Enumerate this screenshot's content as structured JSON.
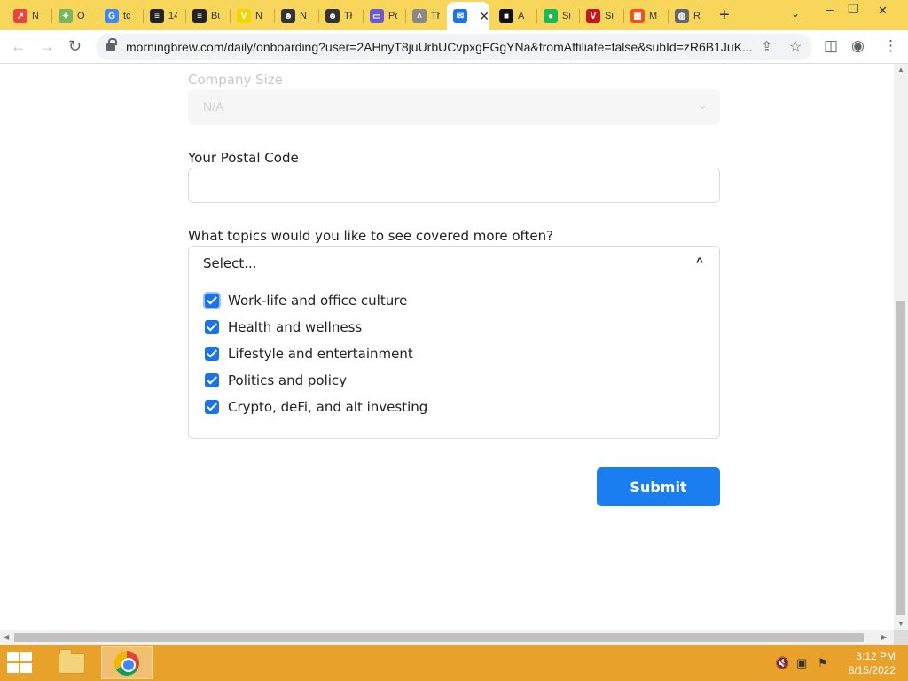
{
  "browser": {
    "tabs": [
      {
        "label": "N",
        "icon": "trending-icon",
        "color": "#e8453c",
        "glyph": "↗"
      },
      {
        "label": "O",
        "icon": "leaf-icon",
        "color": "#7ab55c",
        "glyph": "✦"
      },
      {
        "label": "tc",
        "icon": "google-icon",
        "color": "#4285f4",
        "glyph": "G"
      },
      {
        "label": "14",
        "icon": "layers-icon",
        "color": "#222222",
        "glyph": "≡"
      },
      {
        "label": "Bu",
        "icon": "layers-icon",
        "color": "#222222",
        "glyph": "≡"
      },
      {
        "label": "N",
        "icon": "v-icon",
        "color": "#f2d600",
        "glyph": "V"
      },
      {
        "label": "N",
        "icon": "mascot-icon",
        "color": "#333333",
        "glyph": "☻"
      },
      {
        "label": "Tł",
        "icon": "mascot-icon",
        "color": "#333333",
        "glyph": "☻"
      },
      {
        "label": "Po",
        "icon": "brand-icon",
        "color": "#6a5acd",
        "glyph": "▭"
      },
      {
        "label": "Th",
        "icon": "feather-icon",
        "color": "#888888",
        "glyph": "˄"
      },
      {
        "label": "",
        "icon": "morningbrew-icon",
        "color": "#1a73e8",
        "glyph": "✉",
        "active": true
      },
      {
        "label": "A",
        "icon": "brand-icon",
        "color": "#111111",
        "glyph": "■"
      },
      {
        "label": "Si",
        "icon": "spotify-icon",
        "color": "#1db954",
        "glyph": "●"
      },
      {
        "label": "Si",
        "icon": "v-icon",
        "color": "#c4161c",
        "glyph": "V"
      },
      {
        "label": "M",
        "icon": "microsoft-icon",
        "color": "#f25022",
        "glyph": "▦"
      },
      {
        "label": "R",
        "icon": "globe-icon",
        "color": "#666666",
        "glyph": "◍"
      }
    ],
    "url": "morningbrew.com/daily/onboarding?user=2AHnyT8juUrbUCvpxgFGgYNa&fromAffiliate=false&subId=zR6B1JuK..."
  },
  "form": {
    "company_size_label": "Company Size",
    "company_size_value": "N/A",
    "postal_code_label": "Your Postal Code",
    "postal_code_value": "",
    "topics_label": "What topics would you like to see covered more often?",
    "topics_placeholder": "Select...",
    "topics": [
      {
        "label": "Work-life and office culture",
        "checked": true,
        "focused": true
      },
      {
        "label": "Health and wellness",
        "checked": true
      },
      {
        "label": "Lifestyle and entertainment",
        "checked": true
      },
      {
        "label": "Politics and policy",
        "checked": true
      },
      {
        "label": "Crypto, deFi, and alt investing",
        "checked": true
      }
    ],
    "submit_label": "Submit",
    "accent_color": "#1a7ef0"
  },
  "taskbar": {
    "time": "3:12 PM",
    "date": "8/15/2022"
  }
}
